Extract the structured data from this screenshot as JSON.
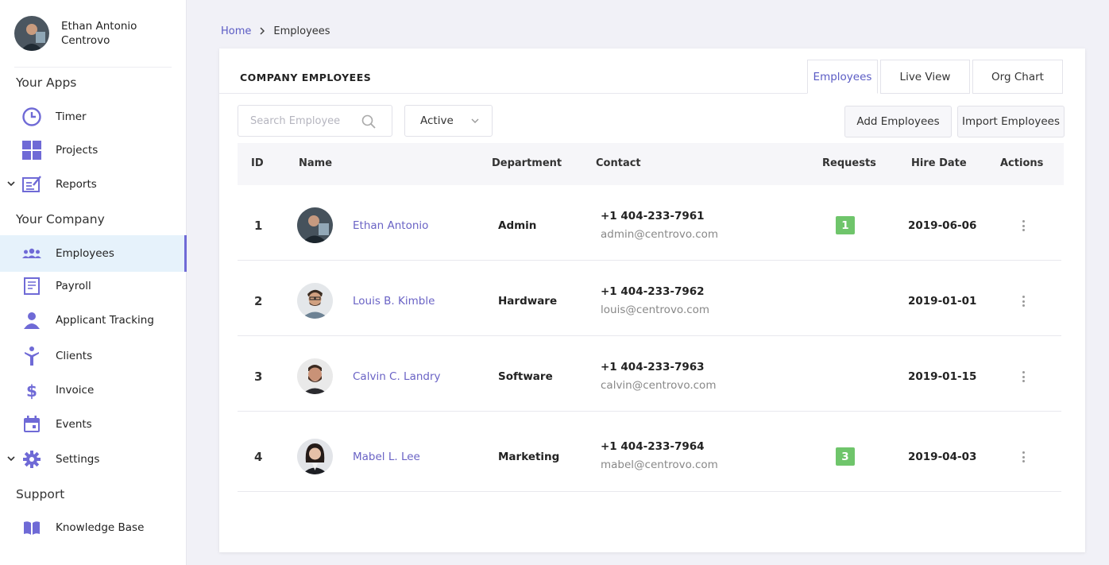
{
  "user": {
    "first_line": "Ethan Antonio",
    "second_line": "Centrovo"
  },
  "sidebar": {
    "sections": [
      "Your Apps",
      "Your Company",
      "Support"
    ],
    "items": [
      {
        "label": "Timer",
        "icon": "clock-icon"
      },
      {
        "label": "Projects",
        "icon": "grid-icon"
      },
      {
        "label": "Reports",
        "icon": "report-icon",
        "expandable": true
      },
      {
        "label": "Employees",
        "icon": "people-icon",
        "active": true
      },
      {
        "label": "Payroll",
        "icon": "payroll-icon"
      },
      {
        "label": "Applicant Tracking",
        "icon": "user-icon"
      },
      {
        "label": "Clients",
        "icon": "client-icon"
      },
      {
        "label": "Invoice",
        "icon": "dollar-icon"
      },
      {
        "label": "Events",
        "icon": "calendar-icon"
      },
      {
        "label": "Settings",
        "icon": "gear-icon",
        "expandable": true
      },
      {
        "label": "Knowledge Base",
        "icon": "book-icon"
      }
    ]
  },
  "breadcrumb": {
    "home": "Home",
    "current": "Employees"
  },
  "card": {
    "title": "COMPANY EMPLOYEES",
    "tabs": [
      "Employees",
      "Live View",
      "Org Chart"
    ],
    "active_tab": "Employees",
    "search_placeholder": "Search Employee",
    "status_filter": "Active",
    "add_button": "Add Employees",
    "import_button": "Import Employees"
  },
  "table": {
    "columns": [
      "ID",
      "Name",
      "Department",
      "Contact",
      "Requests",
      "Hire Date",
      "Actions"
    ],
    "rows": [
      {
        "id": "1",
        "name": "Ethan Antonio",
        "department": "Admin",
        "phone": "+1 404-233-7961",
        "email": "admin@centrovo.com",
        "requests": "1",
        "hire_date": "2019-06-06"
      },
      {
        "id": "2",
        "name": "Louis B. Kimble",
        "department": "Hardware",
        "phone": "+1 404-233-7962",
        "email": "louis@centrovo.com",
        "requests": "",
        "hire_date": "2019-01-01"
      },
      {
        "id": "3",
        "name": "Calvin C. Landry",
        "department": "Software",
        "phone": "+1 404-233-7963",
        "email": "calvin@centrovo.com",
        "requests": "",
        "hire_date": "2019-01-15"
      },
      {
        "id": "4",
        "name": "Mabel L. Lee",
        "department": "Marketing",
        "phone": "+1 404-233-7964",
        "email": "mabel@centrovo.com",
        "requests": "3",
        "hire_date": "2019-04-03"
      }
    ]
  },
  "colors": {
    "accent": "#6f6ad6",
    "link": "#6a63c5",
    "badge": "#6fc56b",
    "active_bg": "#e6f2fb"
  }
}
